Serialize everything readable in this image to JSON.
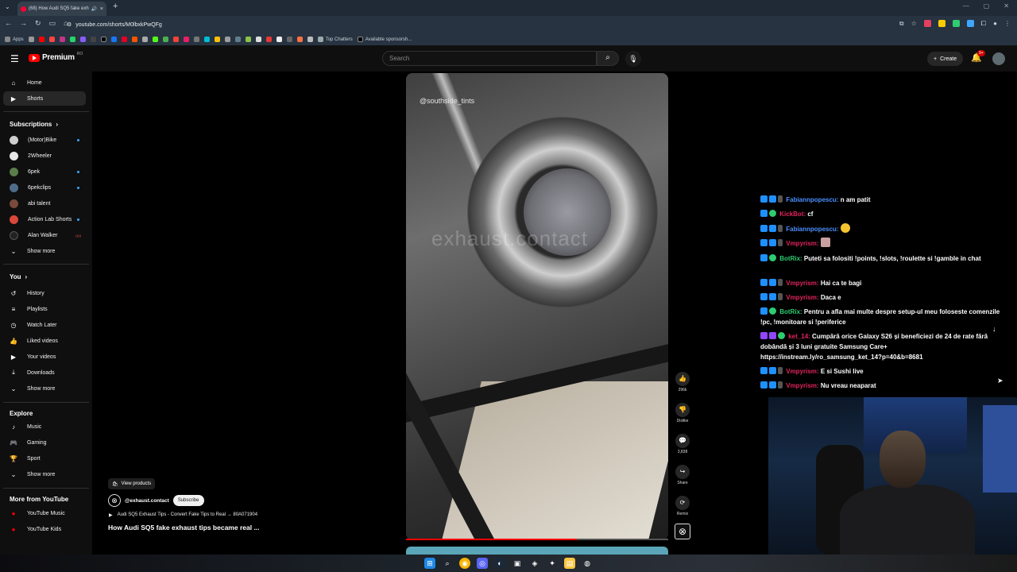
{
  "browser": {
    "tab_title": "(68) How Audi SQ5 fake exh",
    "url": "youtube.com/shorts/M0lbxkPwQFg",
    "bookmarks": {
      "apps_label": "Apps",
      "top_chatters": "Top Chatters",
      "available_sponsorships": "Available sponsorsh..."
    }
  },
  "header": {
    "logo_text": "Premium",
    "logo_sup": "RO",
    "search_placeholder": "Search",
    "create_label": "Create",
    "notif_count": "9+"
  },
  "sidebar": {
    "top_items": [
      {
        "label": "Home",
        "icon": "home-icon"
      },
      {
        "label": "Shorts",
        "icon": "shorts-icon"
      }
    ],
    "subscriptions_title": "Subscriptions",
    "subscriptions": [
      {
        "label": "(Motor)Bike",
        "color": "#cfcfcf"
      },
      {
        "label": "2Wheeler",
        "color": "#e8e8e8"
      },
      {
        "label": "6pek",
        "color": "#5b7d4a"
      },
      {
        "label": "6pekclips",
        "color": "#4f6d8a"
      },
      {
        "label": "abi talent",
        "color": "#7a4a3c"
      },
      {
        "label": "Action Lab Shorts",
        "color": "#d9483b"
      },
      {
        "label": "Alan Walker",
        "color": "#222222"
      }
    ],
    "live_label": "((•))",
    "show_more": "Show more",
    "you_title": "You",
    "you_items": [
      {
        "label": "History",
        "icon": "history-icon"
      },
      {
        "label": "Playlists",
        "icon": "playlists-icon"
      },
      {
        "label": "Watch Later",
        "icon": "watch-later-icon"
      },
      {
        "label": "Liked videos",
        "icon": "liked-icon"
      },
      {
        "label": "Your videos",
        "icon": "your-videos-icon"
      },
      {
        "label": "Downloads",
        "icon": "downloads-icon"
      }
    ],
    "explore_title": "Explore",
    "explore_items": [
      {
        "label": "Music",
        "icon": "music-icon"
      },
      {
        "label": "Gaming",
        "icon": "gaming-icon"
      },
      {
        "label": "Sport",
        "icon": "sport-icon"
      }
    ],
    "more_title": "More from YouTube",
    "more_items": [
      {
        "label": "YouTube Music"
      },
      {
        "label": "YouTube Kids"
      }
    ]
  },
  "short": {
    "watermark_tag": "@southside_tints",
    "watermark_big": "exhaust.contact",
    "progress": 0.65,
    "view_products": "View products",
    "channel": "@exhaust.contact",
    "subscribe": "Subscribe",
    "song": "Audi SQ5 Exhaust Tips - Convert Fake Tips to Real → 80A071904",
    "title": "How Audi SQ5 fake exhaust tips became real ...",
    "actions": {
      "likes": "296k",
      "dislike": "Dislike",
      "comments": "3,838",
      "share": "Share",
      "remix": "Remix"
    }
  },
  "chat": [
    {
      "user": "Fabiannpopescu:",
      "color": "#4a90ff",
      "text": "n am patit"
    },
    {
      "user": "KickBot:",
      "color": "#e0245e",
      "text": "cf"
    },
    {
      "user": "Fabiannpopescu:",
      "color": "#4a90ff",
      "text": ""
    },
    {
      "user": "Vmpyrism:",
      "color": "#e0245e",
      "text": ""
    },
    {
      "user": "BotRix:",
      "color": "#2ecc71",
      "text": "Puteti sa folositi !points, !slots, !roulette si !gamble in chat"
    },
    {
      "user": "Vmpyrism:",
      "color": "#e0245e",
      "text": "Hai ca te bagi"
    },
    {
      "user": "Vmpyrism:",
      "color": "#e0245e",
      "text": "Daca e"
    },
    {
      "user": "BotRix:",
      "color": "#2ecc71",
      "text": "Pentru a afla mai multe despre setup-ul meu foloseste comenzile !pc, !monitoare si !periferice"
    },
    {
      "user": "ket_14:",
      "color": "#e0245e",
      "text": "Cumpără orice Galaxy S26 și beneficiezi de 24 de rate fără dobândă și 3 luni gratuite Samsung Care+ https://instream.ly/ro_samsung_ket_14?p=40&b=8681"
    },
    {
      "user": "Vmpyrism:",
      "color": "#e0245e",
      "text": "E si Sushi live"
    },
    {
      "user": "Vmpyrism:",
      "color": "#e0245e",
      "text": "Nu vreau neaparat"
    }
  ]
}
